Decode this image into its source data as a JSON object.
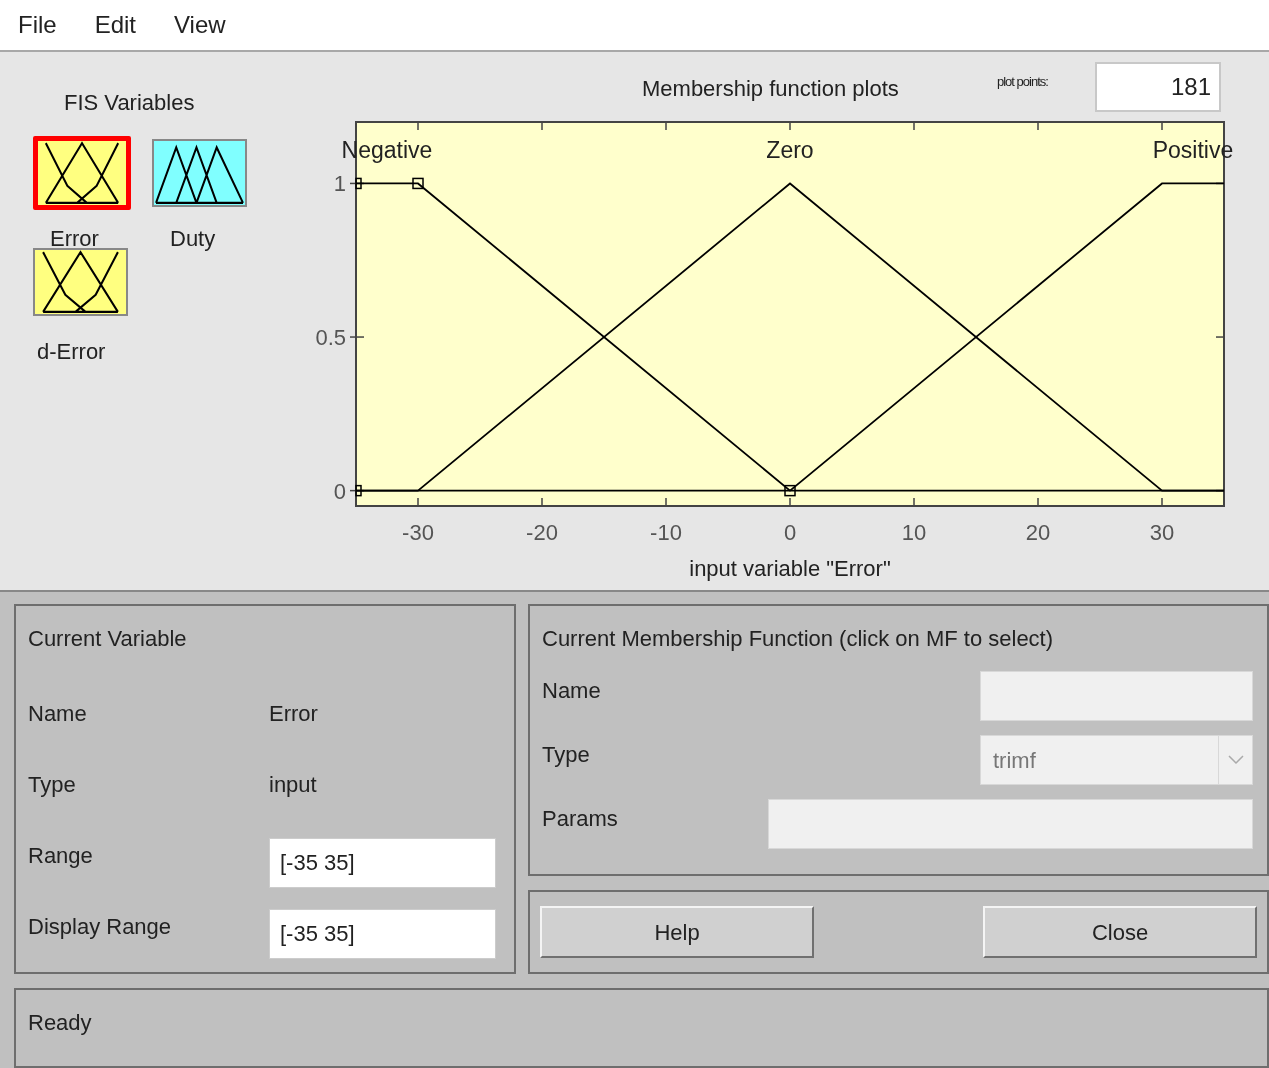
{
  "menu": [
    "File",
    "Edit",
    "View"
  ],
  "fis_variables": {
    "title": "FIS Variables",
    "items": [
      {
        "label": "Error",
        "kind": "input",
        "color": "#ffff80",
        "selected": true
      },
      {
        "label": "Duty",
        "kind": "output",
        "color": "#80ffff",
        "selected": false
      },
      {
        "label": "d-Error",
        "kind": "input",
        "color": "#ffff80",
        "selected": false
      }
    ]
  },
  "plot": {
    "title": "Membership function plots",
    "plot_points": {
      "label": "plot points:",
      "value": "181"
    },
    "chart_data": {
      "type": "line",
      "xlabel": "input variable \"Error\"",
      "x": [
        -35,
        -30,
        0,
        30,
        35
      ],
      "series": [
        {
          "name": "Negative",
          "color": "#000000",
          "values": [
            1,
            1,
            0,
            0,
            0
          ]
        },
        {
          "name": "Zero",
          "color": "#000000",
          "values": [
            0,
            0,
            1,
            0,
            0
          ]
        },
        {
          "name": "Positive",
          "color": "#000000",
          "values": [
            0,
            0,
            0,
            1,
            1
          ]
        }
      ],
      "xlim": [
        -35,
        35
      ],
      "ylim": [
        -0.05,
        1.2
      ],
      "xticks": [
        -30,
        -20,
        -10,
        0,
        10,
        20,
        30
      ],
      "yticks": [
        0,
        0.5,
        1
      ]
    }
  },
  "current_variable": {
    "title": "Current Variable",
    "name": {
      "label": "Name",
      "value": "Error"
    },
    "type": {
      "label": "Type",
      "value": "input"
    },
    "range": {
      "label": "Range",
      "value": "[-35 35]"
    },
    "display_range": {
      "label": "Display Range",
      "value": "[-35 35]"
    }
  },
  "current_mf": {
    "title": "Current Membership Function (click on MF to select)",
    "name": {
      "label": "Name",
      "disabled": true
    },
    "type": {
      "label": "Type",
      "value": "trimf",
      "disabled": true
    },
    "params": {
      "label": "Params",
      "disabled": true
    }
  },
  "buttons": [
    "Help",
    "Close"
  ],
  "status": "Ready"
}
